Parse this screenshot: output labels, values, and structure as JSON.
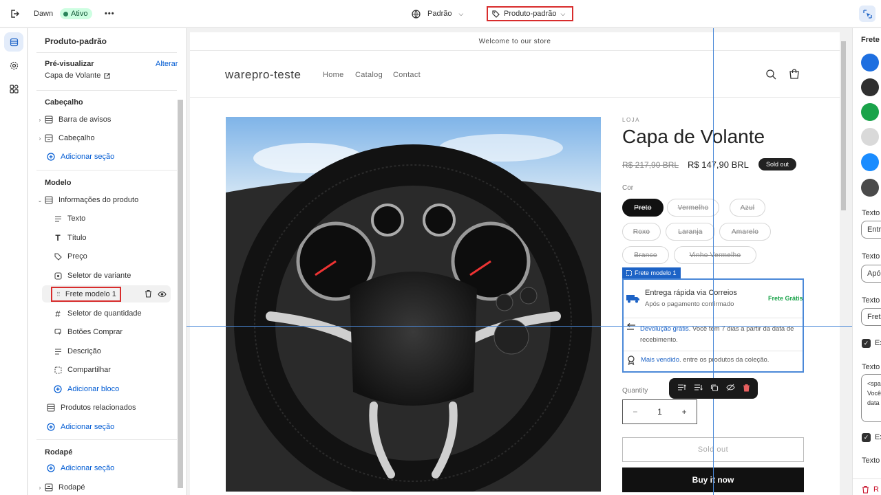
{
  "topbar": {
    "theme_name": "Dawn",
    "status": "Ativo",
    "more": "•••",
    "store_selector": "Padrão",
    "template_selector": "Produto-padrão"
  },
  "sidebar": {
    "title": "Produto-padrão",
    "preview_label": "Pré-visualizar",
    "preview_change": "Alterar",
    "preview_product": "Capa de Volante",
    "header_section": "Cabeçalho",
    "header_items": [
      "Barra de avisos",
      "Cabeçalho"
    ],
    "add_section": "Adicionar seção",
    "template_section": "Modelo",
    "product_info": "Informações do produto",
    "blocks": [
      "Texto",
      "Título",
      "Preço",
      "Seletor de variante",
      "Frete modelo 1",
      "Seletor de quantidade",
      "Botões Comprar",
      "Descrição",
      "Compartilhar"
    ],
    "add_block": "Adicionar bloco",
    "related": "Produtos relacionados",
    "add_section_2": "Adicionar seção",
    "footer_section": "Rodapé",
    "add_section_3": "Adicionar seção",
    "footer_item": "Rodapé"
  },
  "preview": {
    "announcement": "Welcome to our store",
    "logo": "warepro-teste",
    "nav": [
      "Home",
      "Catalog",
      "Contact"
    ],
    "vendor": "LOJA",
    "product_title": "Capa de Volante",
    "compare_price": "R$ 217,90 BRL",
    "price": "R$ 147,90 BRL",
    "sold_out_badge": "Sold out",
    "color_label": "Cor",
    "colors": [
      "Preto",
      "Vermelho",
      "Azul",
      "Roxo",
      "Laranja",
      "Amarelo",
      "Branco",
      "Vinho Vermelho"
    ],
    "freight_tag": "Frete modelo 1",
    "freight": {
      "title": "Entrega rápida via Correios",
      "subtitle": "Após o pagamento confirmado",
      "free": "Frete Grátis",
      "return_link": "Devolução grátis",
      "return_text": ". Você tem 7 dias a partir da data de recebimento.",
      "best_link": "Mais vendido",
      "best_text": ". entre os produtos da coleção."
    },
    "quantity_label": "Quantity",
    "quantity_minus": "−",
    "quantity_value": "1",
    "quantity_plus": "+",
    "sold_out_button": "Sold out",
    "buy_now": "Buy it now"
  },
  "rightpanel": {
    "title": "Frete",
    "swatches": [
      "#1e6fe0",
      "#303030",
      "#1aa34a",
      "#d9d9d9",
      "#1a8cff",
      "#4a4a4a"
    ],
    "labels": [
      "Texto",
      "Texto",
      "Texto",
      "Ex",
      "Texto",
      "Ex",
      "Texto"
    ],
    "input_values": [
      "Entr",
      "Apó",
      "Fret"
    ],
    "textarea_lines": [
      "<spa",
      "Você",
      "data"
    ],
    "remove": "R"
  }
}
